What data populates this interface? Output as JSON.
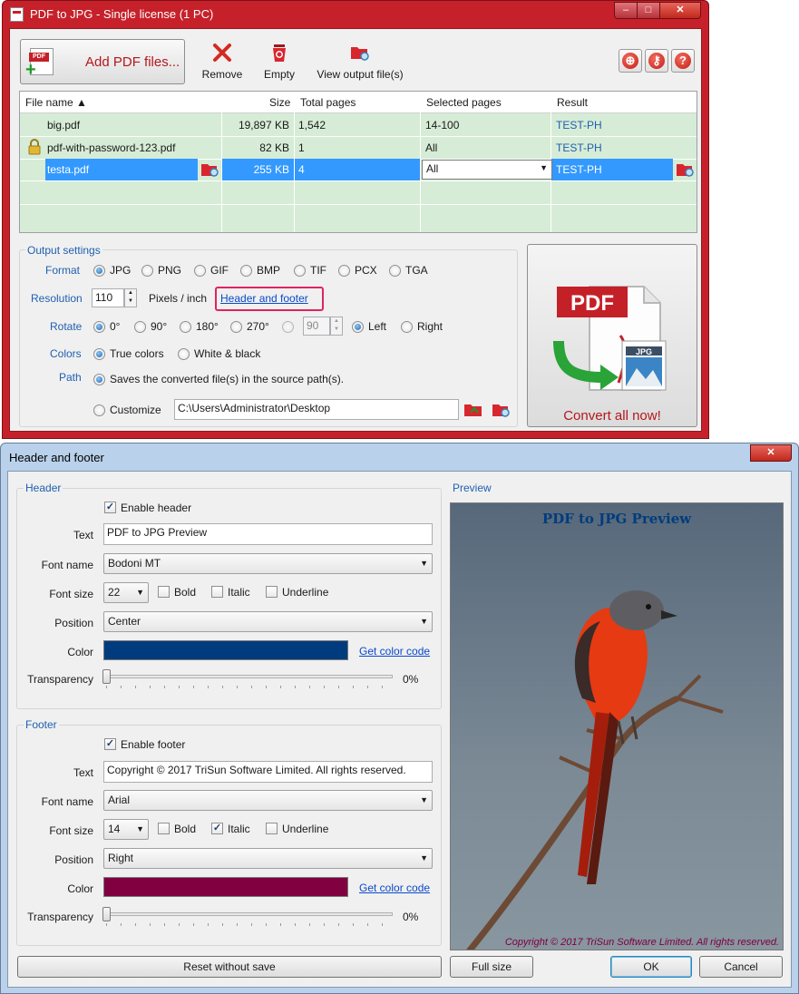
{
  "main_window": {
    "title": "PDF to JPG - Single license (1 PC)",
    "caption_buttons": {
      "minimize": "–",
      "maximize": "□",
      "close": "✕"
    },
    "toolbar": {
      "add_pdf_label": "Add PDF files...",
      "pdf_badge": "PDF",
      "remove_label": "Remove",
      "empty_label": "Empty",
      "view_output_label": "View output file(s)",
      "right_icons": [
        "globe-icon",
        "key-icon",
        "help-icon"
      ]
    },
    "file_table": {
      "columns": [
        "File name ▲",
        "Size",
        "Total pages",
        "Selected pages",
        "Result"
      ],
      "rows": [
        {
          "name": "big.pdf",
          "size": "19,897 KB",
          "total": "1,542",
          "selected": "14-100",
          "result": "TEST-PH",
          "locked": false
        },
        {
          "name": "pdf-with-password-123.pdf",
          "size": "82 KB",
          "total": "1",
          "selected": "All",
          "result": "TEST-PH",
          "locked": true
        },
        {
          "name": "testa.pdf",
          "size": "255 KB",
          "total": "4",
          "selected": "All",
          "result": "TEST-PH",
          "locked": false,
          "selected_row": true
        }
      ]
    },
    "output_settings": {
      "group_label": "Output settings",
      "format_label": "Format",
      "formats": [
        "JPG",
        "PNG",
        "GIF",
        "BMP",
        "TIF",
        "PCX",
        "TGA"
      ],
      "format_selected": "JPG",
      "resolution_label": "Resolution",
      "resolution_value": "110",
      "resolution_unit": "Pixels / inch",
      "header_footer_link": "Header and footer",
      "rotate_label": "Rotate",
      "rotations": [
        "0°",
        "90°",
        "180°",
        "270°"
      ],
      "rotation_selected": "0°",
      "custom_angle": "90",
      "direction": [
        "Left",
        "Right"
      ],
      "direction_selected": "Left",
      "colors_label": "Colors",
      "color_modes": [
        "True colors",
        "White & black"
      ],
      "color_selected": "True colors",
      "path_label": "Path",
      "path_source_text": "Saves the converted file(s) in the source path(s).",
      "customize_label": "Customize",
      "customize_path": "C:\\Users\\Administrator\\Desktop"
    },
    "convert_button": {
      "label": "Convert all now!",
      "art_pdf": "PDF",
      "art_jpg": "JPG"
    }
  },
  "dialog": {
    "title": "Header and footer",
    "close": "✕",
    "header": {
      "group_label": "Header",
      "enable_label": "Enable header",
      "enabled": true,
      "text_label": "Text",
      "text_value": "PDF to JPG Preview",
      "font_name_label": "Font name",
      "font_name": "Bodoni MT",
      "font_size_label": "Font size",
      "font_size": "22",
      "bold_label": "Bold",
      "bold": false,
      "italic_label": "Italic",
      "italic": false,
      "underline_label": "Underline",
      "underline": false,
      "position_label": "Position",
      "position": "Center",
      "color_label": "Color",
      "color": "#003c7d",
      "get_color_code": "Get color code",
      "transparency_label": "Transparency",
      "transparency": "0%"
    },
    "footer": {
      "group_label": "Footer",
      "enable_label": "Enable footer",
      "enabled": true,
      "text_label": "Text",
      "text_value": "Copyright © 2017 TriSun Software Limited. All rights reserved.",
      "font_name_label": "Font name",
      "font_name": "Arial",
      "font_size_label": "Font size",
      "font_size": "14",
      "bold_label": "Bold",
      "bold": false,
      "italic_label": "Italic",
      "italic": true,
      "underline_label": "Underline",
      "underline": false,
      "position_label": "Position",
      "position": "Right",
      "color_label": "Color",
      "color": "#800040",
      "get_color_code": "Get color code",
      "transparency_label": "Transparency",
      "transparency": "0%"
    },
    "preview": {
      "label": "Preview",
      "header_text": "PDF to JPG Preview",
      "footer_text": "Copyright © 2017 TriSun Software Limited. All rights reserved."
    },
    "buttons": {
      "reset": "Reset without save",
      "full_size": "Full size",
      "ok": "OK",
      "cancel": "Cancel"
    }
  }
}
